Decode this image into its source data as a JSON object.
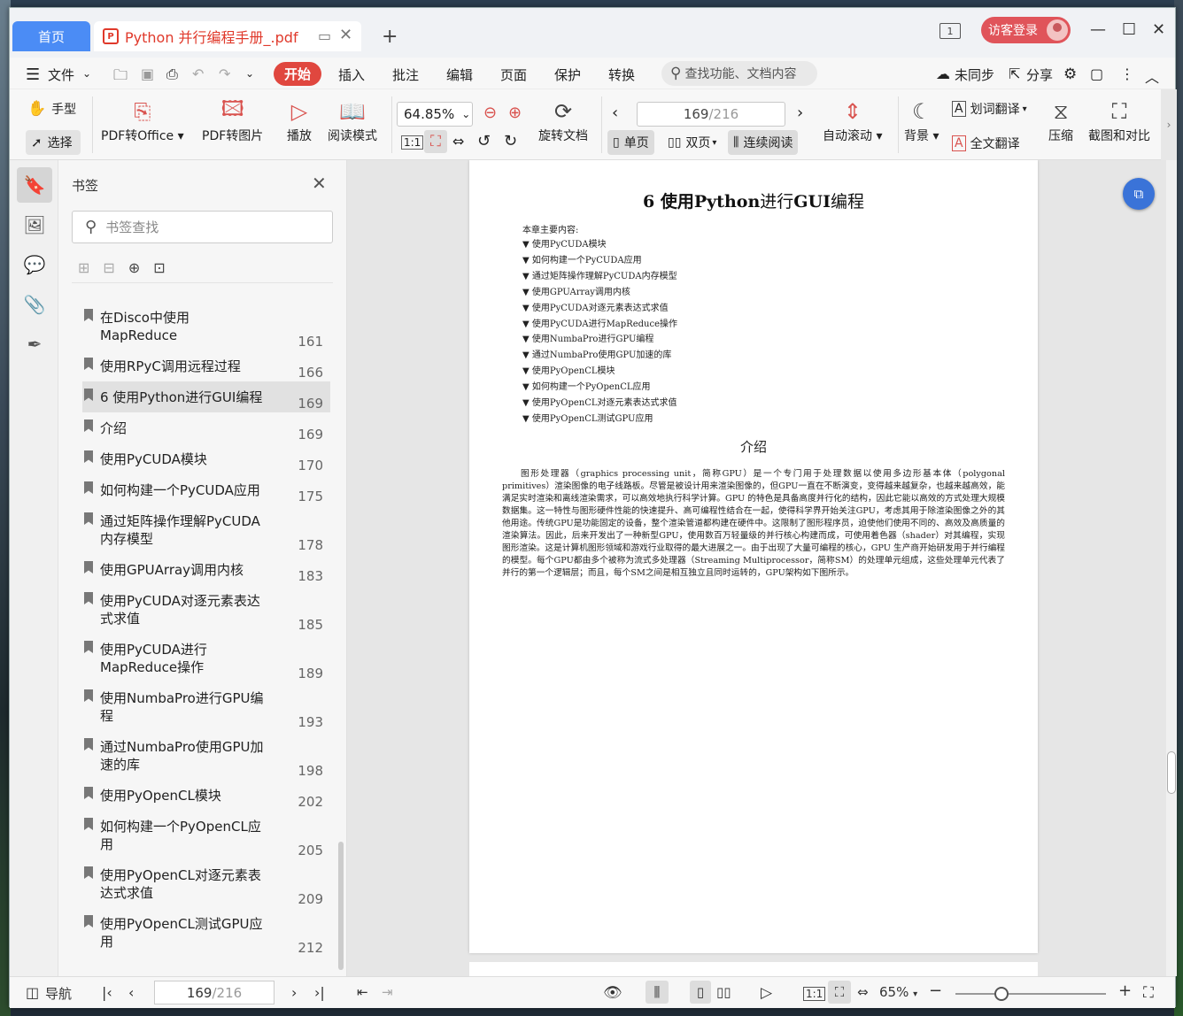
{
  "titlebar": {
    "home_tab": "首页",
    "doc_tab": "Python 并行编程手册_.pdf",
    "pdf_icon": "P",
    "login": "访客登录",
    "page_badge": "1"
  },
  "menu": {
    "file": "文件",
    "start": "开始",
    "items": [
      "插入",
      "批注",
      "编辑",
      "页面",
      "保护",
      "转换"
    ],
    "search_placeholder": "查找功能、文档内容",
    "sync": "未同步",
    "share": "分享"
  },
  "toolbar": {
    "hand": "手型",
    "select": "选择",
    "pdf_office": "PDF转Office",
    "pdf_image": "PDF转图片",
    "play": "播放",
    "read_mode": "阅读模式",
    "zoom": "64.85%",
    "rotate": "旋转文档",
    "page_value": "169",
    "page_total": "/216",
    "single": "单页",
    "double": "双页",
    "continuous": "连续阅读",
    "auto_scroll": "自动滚动",
    "background": "背景",
    "word_translate": "划词翻译",
    "full_translate": "全文翻译",
    "compress": "压缩",
    "screenshot": "截图和对比"
  },
  "bookmarks": {
    "title": "书签",
    "search_placeholder": "书签查找",
    "items": [
      {
        "label": "在Disco中使用MapReduce",
        "page": "161",
        "lines": 2
      },
      {
        "label": "使用RPyC调用远程过程",
        "page": "166",
        "lines": 1
      },
      {
        "label": "6 使用Python进行GUI编程",
        "page": "169",
        "lines": 1,
        "active": true
      },
      {
        "label": "介绍",
        "page": "169",
        "lines": 1
      },
      {
        "label": "使用PyCUDA模块",
        "page": "170",
        "lines": 1
      },
      {
        "label": "如何构建一个PyCUDA应用",
        "page": "175",
        "lines": 1
      },
      {
        "label": "通过矩阵操作理解PyCUDA内存模型",
        "page": "178",
        "lines": 2
      },
      {
        "label": "使用GPUArray调用内核",
        "page": "183",
        "lines": 1
      },
      {
        "label": "使用PyCUDA对逐元素表达式求值",
        "page": "185",
        "lines": 2
      },
      {
        "label": "使用PyCUDA进行MapReduce操作",
        "page": "189",
        "lines": 2
      },
      {
        "label": "使用NumbaPro进行GPU编程",
        "page": "193",
        "lines": 2
      },
      {
        "label": "通过NumbaPro使用GPU加速的库",
        "page": "198",
        "lines": 2
      },
      {
        "label": "使用PyOpenCL模块",
        "page": "202",
        "lines": 1
      },
      {
        "label": "如何构建一个PyOpenCL应用",
        "page": "205",
        "lines": 2
      },
      {
        "label": "使用PyOpenCL对逐元素表达式求值",
        "page": "209",
        "lines": 2
      },
      {
        "label": "使用PyOpenCL测试GPU应用",
        "page": "212",
        "lines": 2
      }
    ]
  },
  "document": {
    "heading_num": "6 使用",
    "heading_bold": "Python",
    "heading_mid": "进行",
    "heading_bold2": "GUI",
    "heading_end": "编程",
    "intro": "本章主要内容:",
    "toc": [
      "使用PyCUDA模块",
      "如何构建一个PyCUDA应用",
      "通过矩阵操作理解PyCUDA内存模型",
      "使用GPUArray调用内核",
      "使用PyCUDA对逐元素表达式求值",
      "使用PyCUDA进行MapReduce操作",
      "使用NumbaPro进行GPU编程",
      "通过NumbaPro使用GPU加速的库",
      "使用PyOpenCL模块",
      "如何构建一个PyOpenCL应用",
      "使用PyOpenCL对逐元素表达式求值",
      "使用PyOpenCL测试GPU应用"
    ],
    "section": "介绍",
    "paragraph": "图形处理器（graphics processing unit，简称GPU）是一个专门用于处理数据以使用多边形基本体（polygonal primitives）渲染图像的电子线路板。尽管是被设计用来渲染图像的，但GPU一直在不断演变，变得越来越复杂，也越来越高效，能满足实时渲染和离线渲染需求，可以高效地执行科学计算。GPU 的特色是具备高度并行化的结构，因此它能以高效的方式处理大规模数据集。这一特性与图形硬件性能的快速提升、高可编程性结合在一起，使得科学界开始关注GPU，考虑其用于除渲染图像之外的其他用途。传统GPU是功能固定的设备，整个渲染管道都构建在硬件中。这限制了图形程序员，迫使他们使用不同的、高效及高质量的渲染算法。因此，后来开发出了一种新型GPU，使用数百万轻量级的并行核心构建而成，可使用着色器（shader）对其编程，实现图形渲染。这是计算机图形领域和游戏行业取得的最大进展之一。由于出现了大量可编程的核心，GPU 生产商开始研发用于并行编程的模型。每个GPU都由多个被称为流式多处理器（Streaming Multiprocessor，简称SM）的处理单元组成，这些处理单元代表了并行的第一个逻辑层；而且，每个SM之间是相互独立且同时运转的，GPU架构如下图所示。"
  },
  "status": {
    "nav": "导航",
    "page_value": "169",
    "page_total": "/216",
    "zoom": "65%"
  }
}
